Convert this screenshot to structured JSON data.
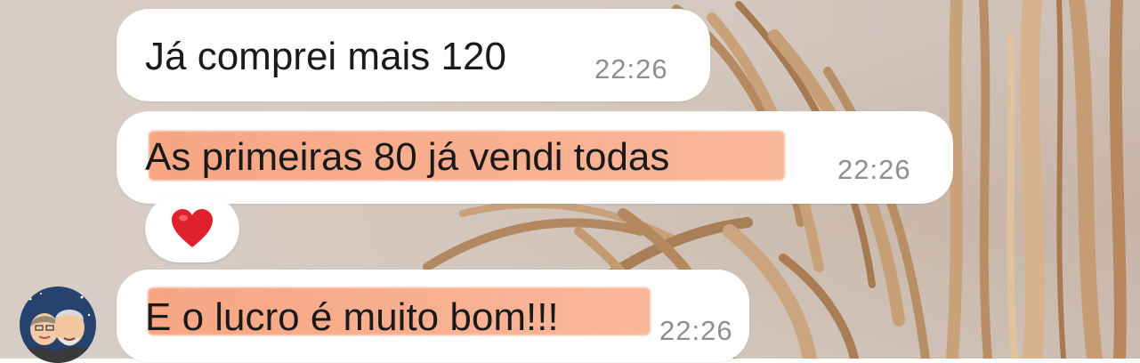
{
  "chat": {
    "messages": [
      {
        "text": "Já comprei mais 120",
        "time": "22:26",
        "highlighted": false
      },
      {
        "text": "As primeiras 80 já vendi todas",
        "time": "22:26",
        "highlighted": true,
        "reaction": "heart-emoji"
      },
      {
        "text": "E o lucro é muito bom!!!",
        "time": "22:26",
        "highlighted": true
      }
    ]
  },
  "colors": {
    "bubble": "#ffffff",
    "highlight": "#f7966e",
    "time": "#8e8e8e",
    "text": "#1a1a1a",
    "wallpaper": "#d6cbc3",
    "heart": "#e0202a"
  },
  "icons": {
    "reaction": "heart-emoji",
    "avatar": "sender-avatar"
  }
}
